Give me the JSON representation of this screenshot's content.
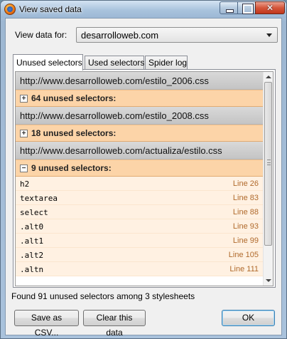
{
  "window": {
    "title": "View saved data"
  },
  "view_for": {
    "label": "View data for:",
    "selected": "desarrolloweb.com"
  },
  "tabs": [
    {
      "label": "Unused selectors",
      "active": true
    },
    {
      "label": "Used selectors",
      "active": false
    },
    {
      "label": "Spider log",
      "active": false
    }
  ],
  "stylesheets": [
    {
      "url": "http://www.desarrolloweb.com/estilo_2006.css",
      "summary": "64 unused selectors:",
      "expanded": false
    },
    {
      "url": "http://www.desarrolloweb.com/estilo_2008.css",
      "summary": "18 unused selectors:",
      "expanded": false
    },
    {
      "url": "http://www.desarrolloweb.com/actualiza/estilo.css",
      "summary": "9 unused selectors:",
      "expanded": true
    }
  ],
  "selectors": [
    {
      "name": "h2",
      "line": "Line 26"
    },
    {
      "name": "textarea",
      "line": "Line 83"
    },
    {
      "name": "select",
      "line": "Line 88"
    },
    {
      "name": ".alt0",
      "line": "Line 93"
    },
    {
      "name": ".alt1",
      "line": "Line 99"
    },
    {
      "name": ".alt2",
      "line": "Line 105"
    },
    {
      "name": ".altn",
      "line": "Line 111"
    }
  ],
  "status_text": "Found 91 unused selectors among 3 stylesheets",
  "buttons": {
    "save": "Save as CSV...",
    "clear": "Clear this data",
    "ok": "OK"
  },
  "icons": {
    "expand": "+",
    "collapse": "−"
  }
}
